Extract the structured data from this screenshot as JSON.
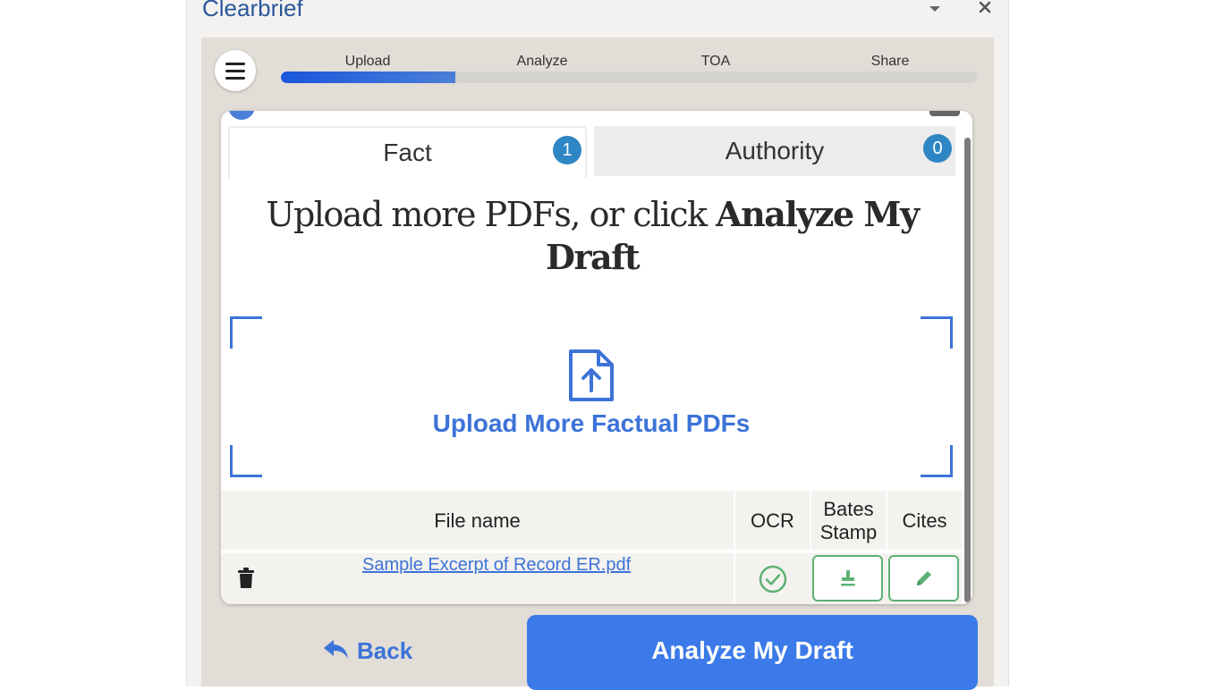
{
  "pane": {
    "title": "Clearbrief"
  },
  "steps": {
    "items": [
      "Upload",
      "Analyze",
      "TOA",
      "Share"
    ],
    "progress_fraction": 0.25
  },
  "tabs": {
    "fact": {
      "label": "Fact",
      "count": "1"
    },
    "authority": {
      "label": "Authority",
      "count": "0"
    }
  },
  "headline": {
    "prefix": "Upload more PDFs, or click ",
    "bold": "Analyze My Draft"
  },
  "dropzone": {
    "label": "Upload More Factual PDFs"
  },
  "table": {
    "headers": {
      "file_name": "File name",
      "ocr": "OCR",
      "bates_line1": "Bates",
      "bates_line2": "Stamp",
      "cites": "Cites"
    },
    "rows": [
      {
        "file_name": "Sample Excerpt of Record ER.pdf"
      }
    ]
  },
  "footer": {
    "back_label": "Back",
    "analyze_label": "Analyze My Draft"
  },
  "colors": {
    "accent": "#3c73d8",
    "primary_button": "#3b7ae8",
    "badge": "#2f86c4",
    "success": "#5db174"
  },
  "icons": {
    "menu": "hamburger-icon",
    "upload": "file-upload-icon",
    "trash": "trash-icon",
    "ocr": "check-circle-icon",
    "bates": "stamp-icon",
    "cites": "pencil-icon",
    "back": "reply-arrow-icon"
  }
}
